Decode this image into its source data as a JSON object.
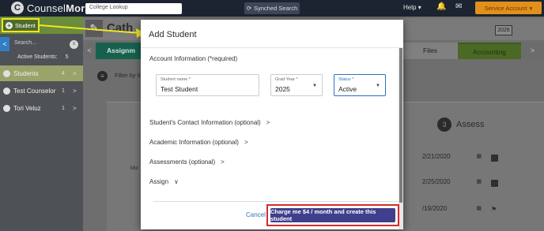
{
  "topbar": {
    "brand_light": "Counsel",
    "brand_bold": "More",
    "lookup_placeholder": "College Lookup",
    "synced_label": "Synched Search",
    "help_label": "Help",
    "help_caret": "▾",
    "bell_icon": "🔔",
    "message_icon": "✉",
    "account_label": "Service Account",
    "account_caret": "▾"
  },
  "sidebar": {
    "student_button_label": "Student",
    "back_arrow": "<",
    "search_placeholder": "Search...",
    "active_label": "Active Students:",
    "active_count": "5",
    "items": [
      {
        "label": "Students",
        "count": "4",
        "chevron": ">"
      },
      {
        "label": "Test Counselor",
        "count": "1",
        "chevron": ">"
      },
      {
        "label": "Tori Veluz",
        "count": "1",
        "chevron": ">"
      }
    ]
  },
  "background_page": {
    "student_title": "Cath",
    "year_badge": "2026",
    "tab_assign": "Assignm",
    "tab_files": "Files",
    "tab_accounting": "Accounting",
    "tab_prev": "<",
    "tab_next": ">",
    "filter_label": "Filter by tit",
    "assess_number": "3",
    "assess_label": "Assess",
    "dates": [
      "2/21/2020",
      "2/25/2020",
      "/19/2020"
    ],
    "partial_text": "Mol"
  },
  "modal": {
    "title": "Add Student",
    "account_section": "Account Information (*required)",
    "fields": {
      "name": {
        "label": "Student name *",
        "value": "Test Student"
      },
      "grad_year": {
        "label": "Grad Year *",
        "value": "2025"
      },
      "status": {
        "label": "Status *",
        "value": "Active"
      }
    },
    "sections": [
      {
        "label": "Student's Contact Information (optional)",
        "chevron": ">"
      },
      {
        "label": "Academic Information (optional)",
        "chevron": ">"
      },
      {
        "label": "Assessments (optional)",
        "chevron": ">"
      },
      {
        "label": "Assign",
        "chevron": "∨"
      }
    ],
    "cancel_label": "Cancel",
    "submit_label": "Charge me $4 / month and create this student"
  },
  "colors": {
    "accent": "#3f3f8c",
    "highlight_border": "#d12d2d",
    "annotation": "#f1e61f",
    "tab_assign": "#17604e",
    "account_button": "#e2901c"
  }
}
